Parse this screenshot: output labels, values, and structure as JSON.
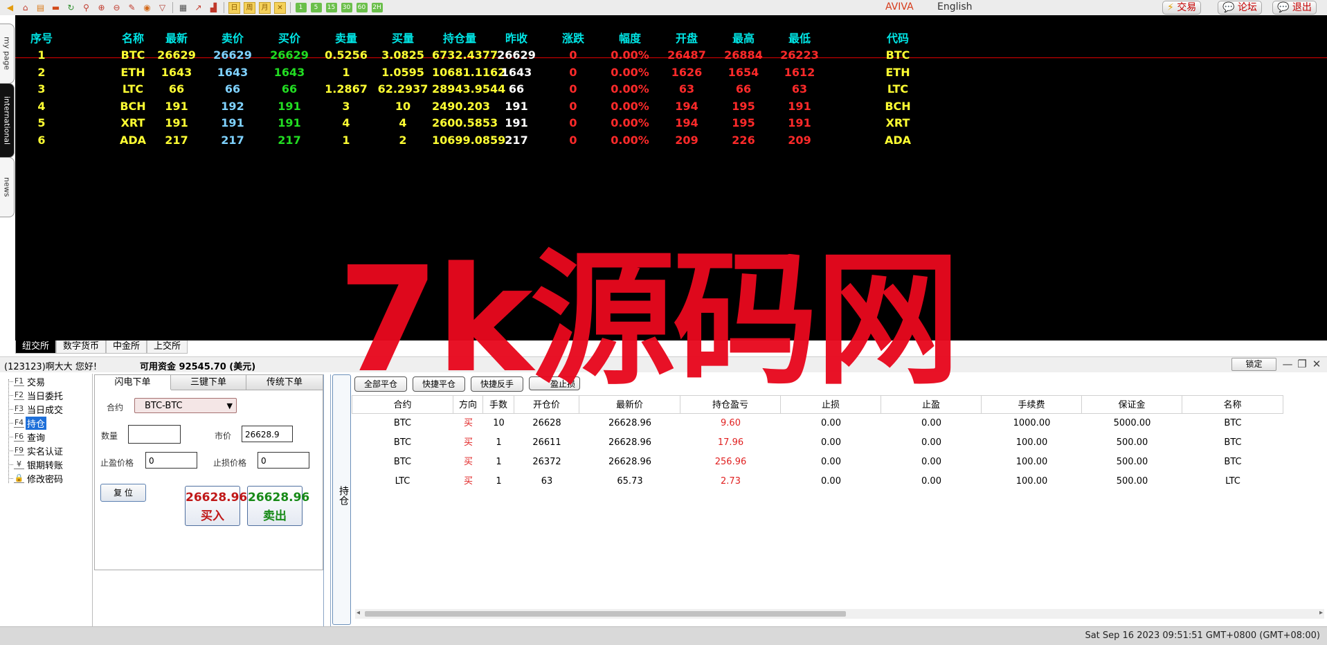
{
  "toolbar": {
    "icons": [
      "back-icon",
      "home-icon",
      "book-icon",
      "card-icon",
      "refresh-icon",
      "search-icon",
      "zoom-in-icon",
      "zoom-out-icon",
      "pen-icon",
      "bucket-icon",
      "filter-icon",
      "table-icon",
      "line-chart-icon",
      "bar-trend-icon"
    ],
    "periods": [
      "日",
      "周",
      "月",
      "✕"
    ],
    "minutes": [
      "1",
      "5",
      "15",
      "30",
      "60",
      "2H"
    ],
    "brand": "AVIVA",
    "language": "English",
    "buttons": [
      {
        "label": "交易",
        "icon": "lightning-icon"
      },
      {
        "label": "论坛",
        "icon": "chat-icon"
      },
      {
        "label": "退出",
        "icon": "chat-icon"
      }
    ]
  },
  "side_tabs": [
    "my page",
    "international",
    "news"
  ],
  "board": {
    "headers": [
      "序号",
      "名称",
      "最新",
      "卖价",
      "买价",
      "卖量",
      "买量",
      "持仓量",
      "昨收",
      "涨跌",
      "幅度",
      "开盘",
      "最高",
      "最低",
      "代码"
    ],
    "rows": [
      [
        "1",
        "BTC",
        "26629",
        "26629",
        "26629",
        "0.5256",
        "3.0825",
        "6732.4377",
        "26629",
        "0",
        "0.00%",
        "26487",
        "26884",
        "26223",
        "BTC"
      ],
      [
        "2",
        "ETH",
        "1643",
        "1643",
        "1643",
        "1",
        "1.0595",
        "10681.1162",
        "1643",
        "0",
        "0.00%",
        "1626",
        "1654",
        "1612",
        "ETH"
      ],
      [
        "3",
        "LTC",
        "66",
        "66",
        "66",
        "1.2867",
        "62.2937",
        "28943.9544",
        "66",
        "0",
        "0.00%",
        "63",
        "66",
        "63",
        "LTC"
      ],
      [
        "4",
        "BCH",
        "191",
        "192",
        "191",
        "3",
        "10",
        "2490.203",
        "191",
        "0",
        "0.00%",
        "194",
        "195",
        "191",
        "BCH"
      ],
      [
        "5",
        "XRT",
        "191",
        "191",
        "191",
        "4",
        "4",
        "2600.5853",
        "191",
        "0",
        "0.00%",
        "194",
        "195",
        "191",
        "XRT"
      ],
      [
        "6",
        "ADA",
        "217",
        "217",
        "217",
        "1",
        "2",
        "10699.0859",
        "217",
        "0",
        "0.00%",
        "209",
        "226",
        "209",
        "ADA"
      ]
    ],
    "colors": {
      "header": "#00e5e5",
      "yellow": "#ffff33",
      "white": "#ffffff",
      "blue": "#7fd2ff",
      "green": "#22dd22",
      "red": "#ff2a2a"
    }
  },
  "market_tabs": [
    "纽交所",
    "数字货币",
    "中金所",
    "上交所"
  ],
  "account": {
    "greeting": "(123123)啊大大 您好!",
    "funds": "可用资金 92545.70 (美元)",
    "lock_label": "锁定"
  },
  "tree": [
    {
      "key": "F1",
      "label": "交易"
    },
    {
      "key": "F2",
      "label": "当日委托"
    },
    {
      "key": "F3",
      "label": "当日成交"
    },
    {
      "key": "F4",
      "label": "持仓"
    },
    {
      "key": "F6",
      "label": "查询"
    },
    {
      "key": "F9",
      "label": "实名认证"
    },
    {
      "key": "¥",
      "label": "银期转账"
    },
    {
      "key": "🔒",
      "label": "修改密码"
    }
  ],
  "order": {
    "tabs": [
      "闪电下单",
      "三键下单",
      "传统下单"
    ],
    "contract_label": "合约",
    "contract_value": "BTC-BTC",
    "qty_label": "数量",
    "qty_value": "",
    "market_label": "市价",
    "market_value": "26628.9",
    "tp_label": "止盈价格",
    "tp_value": "0",
    "sl_label": "止损价格",
    "sl_value": "0",
    "reset_label": "复 位",
    "buy_price": "26628.96",
    "buy_label": "买入",
    "sell_price": "26628.96",
    "sell_label": "卖出"
  },
  "positions": {
    "tab_label": "持仓",
    "buttons": [
      "全部平仓",
      "快捷平仓",
      "快捷反手",
      "盈止损"
    ],
    "columns": [
      "合约",
      "方向",
      "手数",
      "开仓价",
      "最新价",
      "持仓盈亏",
      "止损",
      "止盈",
      "手续费",
      "保证金",
      "名称"
    ],
    "rows": [
      [
        "BTC",
        "买",
        "10",
        "26628",
        "26628.96",
        "9.60",
        "0.00",
        "0.00",
        "1000.00",
        "5000.00",
        "BTC"
      ],
      [
        "BTC",
        "买",
        "1",
        "26611",
        "26628.96",
        "17.96",
        "0.00",
        "0.00",
        "100.00",
        "500.00",
        "BTC"
      ],
      [
        "BTC",
        "买",
        "1",
        "26372",
        "26628.96",
        "256.96",
        "0.00",
        "0.00",
        "100.00",
        "500.00",
        "BTC"
      ],
      [
        "LTC",
        "买",
        "1",
        "63",
        "65.73",
        "2.73",
        "0.00",
        "0.00",
        "100.00",
        "500.00",
        "LTC"
      ]
    ]
  },
  "status_time": "Sat Sep 16 2023 09:51:51 GMT+0800 (GMT+08:00)",
  "watermark": "7k源码网"
}
